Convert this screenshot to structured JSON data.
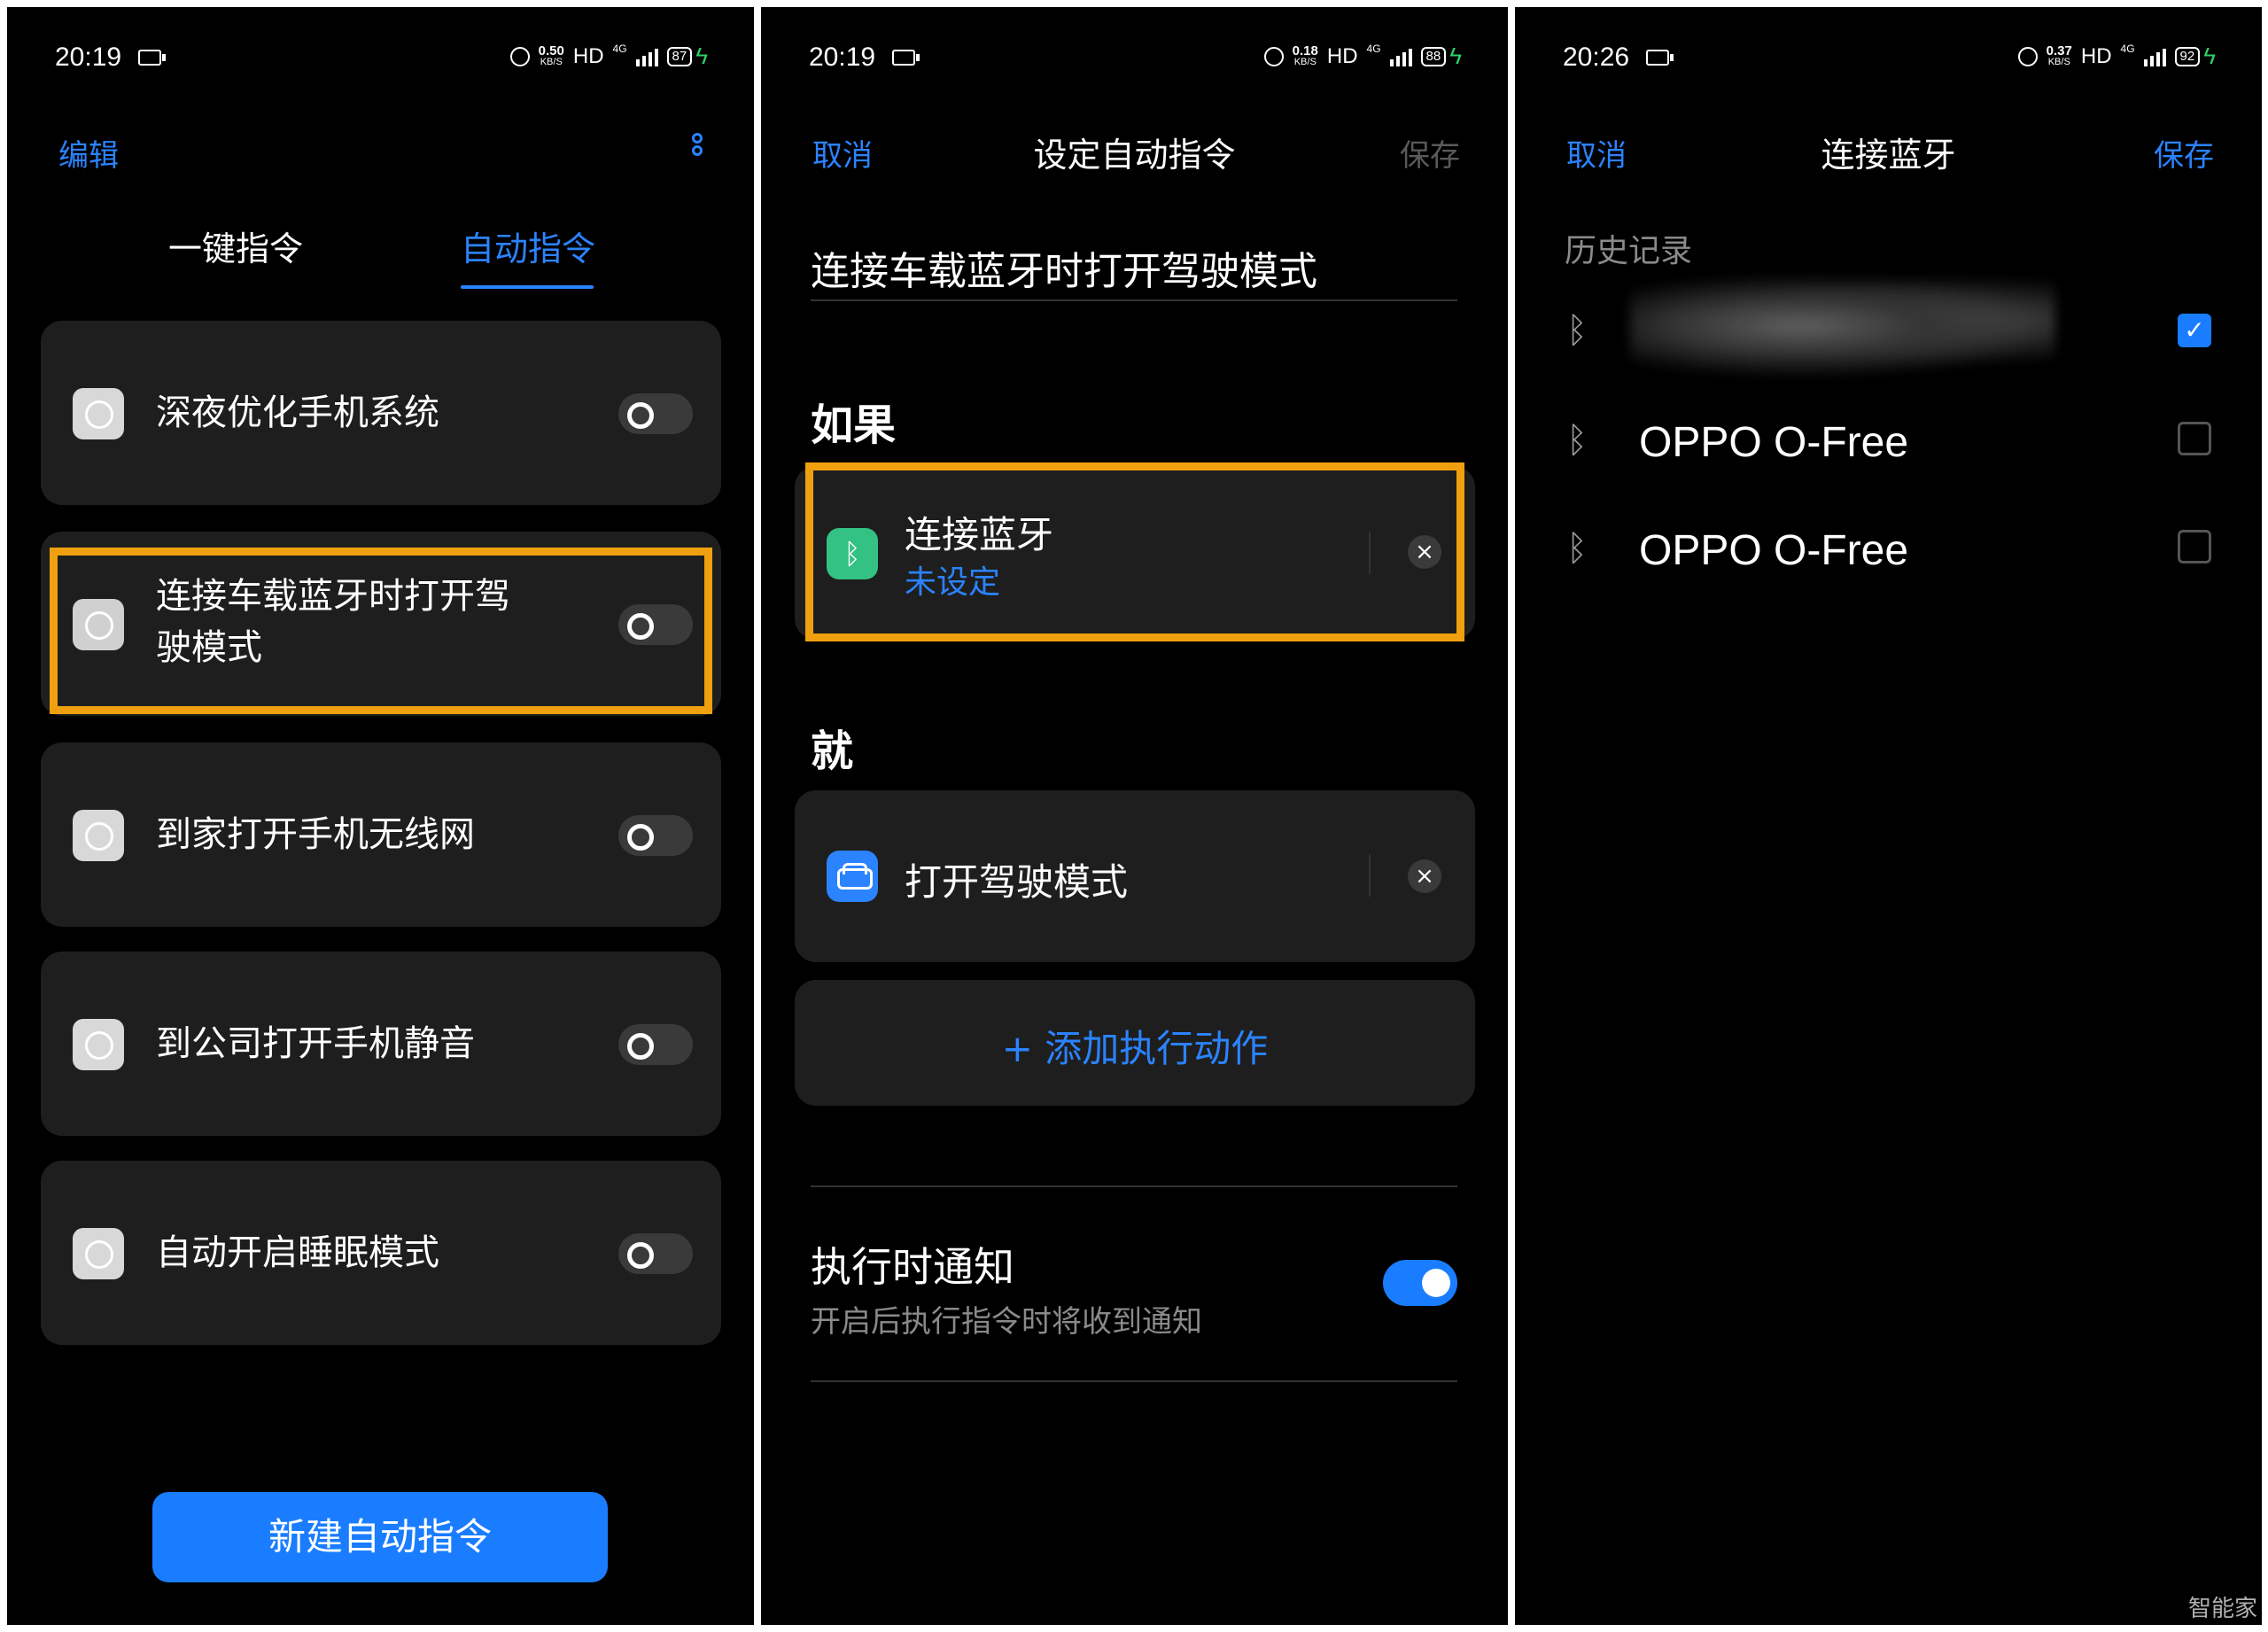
{
  "screens": [
    {
      "status": {
        "time": "20:19",
        "speed": "0.50",
        "speed_unit": "KB/S",
        "hd": "HD",
        "net": "4G",
        "battery": "87"
      },
      "nav": {
        "left": "编辑"
      },
      "tabs": [
        "一键指令",
        "自动指令"
      ],
      "items": [
        {
          "label": "深夜优化手机系统"
        },
        {
          "label": "连接车载蓝牙时打开驾",
          "label2": "驶模式"
        },
        {
          "label": "到家打开手机无线网"
        },
        {
          "label": "到公司打开手机静音"
        },
        {
          "label": "自动开启睡眠模式"
        }
      ],
      "primary_button": "新建自动指令"
    },
    {
      "status": {
        "time": "20:19",
        "speed": "0.18",
        "speed_unit": "KB/S",
        "hd": "HD",
        "net": "4G",
        "battery": "88"
      },
      "nav": {
        "left": "取消",
        "title": "设定自动指令",
        "right": "保存"
      },
      "name": "连接车载蓝牙时打开驾驶模式",
      "if_label": "如果",
      "trigger": {
        "title": "连接蓝牙",
        "subtitle": "未设定"
      },
      "then_label": "就",
      "action": {
        "title": "打开驾驶模式"
      },
      "add_action": "+ 添加执行动作",
      "notify": {
        "title": "执行时通知",
        "subtitle": "开启后执行指令时将收到通知",
        "enabled": true
      }
    },
    {
      "status": {
        "time": "20:26",
        "speed": "0.37",
        "speed_unit": "KB/S",
        "hd": "HD",
        "net": "4G",
        "battery": "92"
      },
      "nav": {
        "left": "取消",
        "title": "连接蓝牙",
        "right": "保存"
      },
      "history_label": "历史记录",
      "devices": [
        {
          "name": "",
          "checked": true
        },
        {
          "name": "OPPO O-Free",
          "checked": false
        },
        {
          "name": "OPPO O-Free",
          "checked": false
        }
      ]
    }
  ],
  "watermark": "智能家",
  "colors": {
    "accent": "#2b83ff",
    "highlight": "#f0a00f",
    "bluetooth_green": "#34c184",
    "card": "#1e1e1e"
  }
}
